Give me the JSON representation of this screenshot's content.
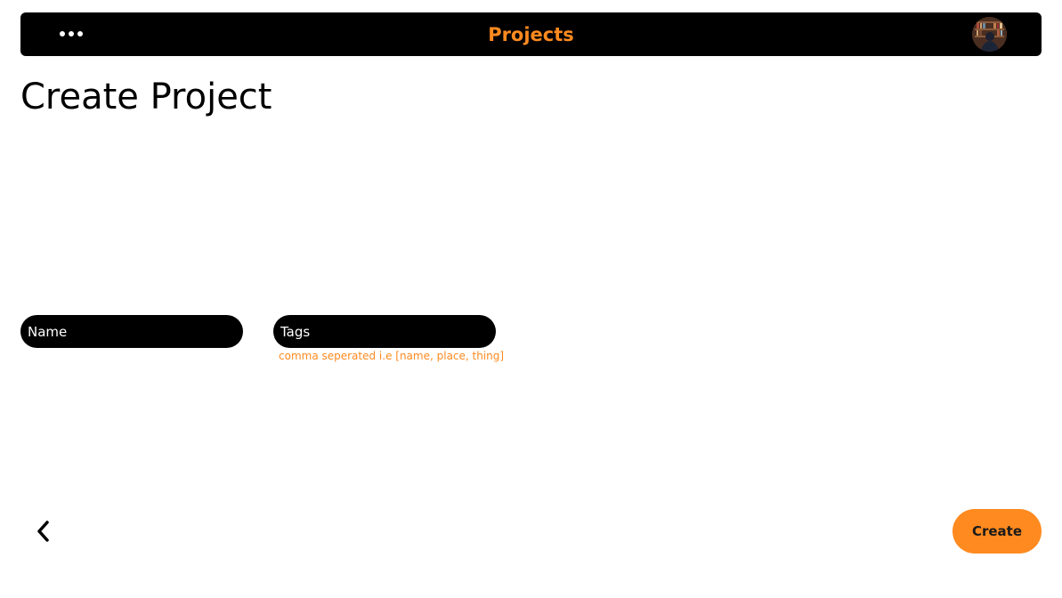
{
  "header": {
    "title": "Projects",
    "menu_icon": "more-horizontal-icon",
    "avatar_icon": "user-avatar"
  },
  "page": {
    "title": "Create Project"
  },
  "form": {
    "name": {
      "placeholder": "Name",
      "value": ""
    },
    "tags": {
      "placeholder": "Tags",
      "value": "",
      "hint": "comma seperated i.e [name, place, thing]"
    }
  },
  "actions": {
    "back_icon": "chevron-left-icon",
    "create_label": "Create"
  },
  "colors": {
    "accent": "#ff8a1f",
    "bar": "#000000",
    "background": "#ffffff"
  }
}
